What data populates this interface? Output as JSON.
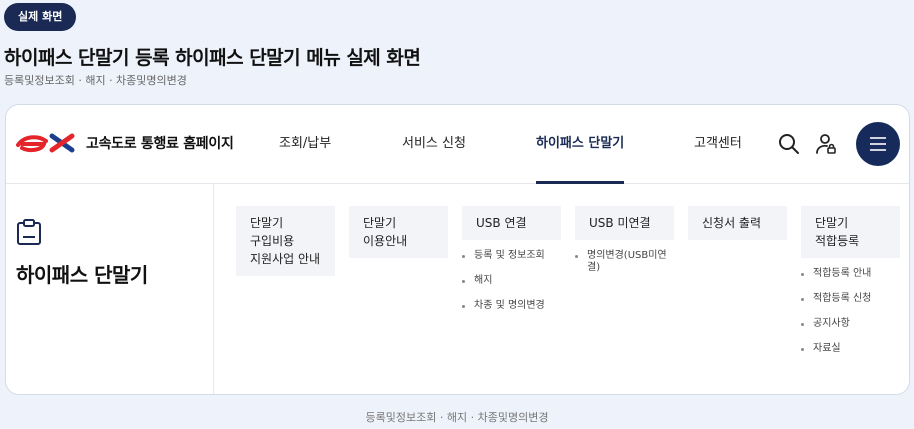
{
  "badge": "실제 화면",
  "page_title": "하이패스 단말기 등록 하이패스 단말기 메뉴 실제 화면",
  "page_subtitle": "등록및정보조회 · 해지 · 차종및명의변경",
  "header": {
    "logo_text": "고속도로 통행료 홈페이지",
    "nav": [
      "조회/납부",
      "서비스 신청",
      "하이패스 단말기",
      "고객센터"
    ],
    "active_nav": "하이패스 단말기",
    "icons": [
      "search-icon",
      "user-lock-icon",
      "hamburger-menu-icon"
    ]
  },
  "sidebar": {
    "icon": "clipboard-icon",
    "title": "하이패스 단말기"
  },
  "columns": [
    {
      "head": "단말기\n구입비용\n지원사업 안내",
      "items": []
    },
    {
      "head": "단말기\n이용안내",
      "items": []
    },
    {
      "head": "USB 연결",
      "items": [
        "등록 및 정보조회",
        "해지",
        "차종 및 명의변경"
      ]
    },
    {
      "head": "USB 미연결",
      "items": [
        "명의변경(USB미연결)"
      ]
    },
    {
      "head": "신청서 출력",
      "items": []
    },
    {
      "head": "단말기\n적합등록",
      "items": [
        "적합등록 안내",
        "적합등록 신청",
        "공지사항",
        "자료실"
      ]
    }
  ],
  "footer_subtitle": "등록및정보조회 · 해지 · 차종및명의변경",
  "colors": {
    "navy": "#1a2a55",
    "logo_red": "#e4262a",
    "logo_blue": "#1b3f8c"
  }
}
